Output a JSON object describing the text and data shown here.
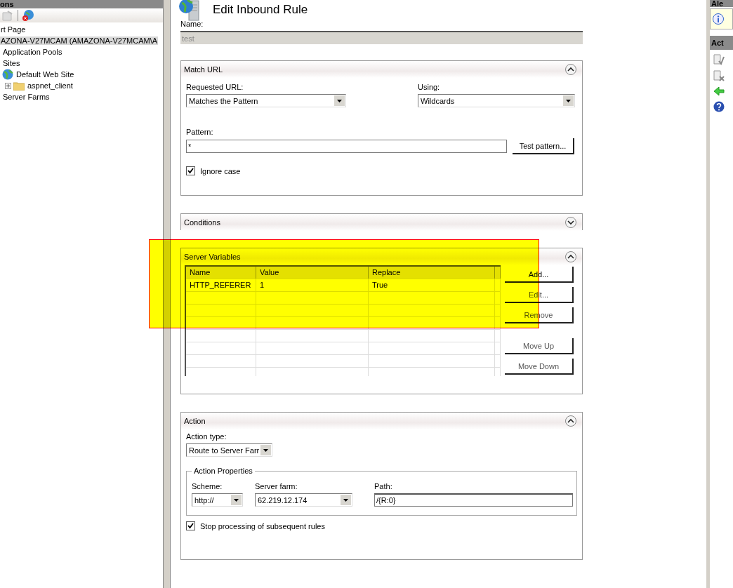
{
  "connections": {
    "title": "ons",
    "tree": [
      {
        "label": "rt Page",
        "selected": false
      },
      {
        "label": "AZONA-V27MCAM (AMAZONA-V27MCAM\\A",
        "selected": true,
        "children": [
          {
            "label": "Application Pools",
            "selected": false
          },
          {
            "label": "Sites",
            "selected": false,
            "children": [
              {
                "label": "Default Web Site",
                "selected": false,
                "kind": "site",
                "children": [
                  {
                    "label": "aspnet_client",
                    "selected": false,
                    "kind": "folder"
                  }
                ]
              }
            ]
          },
          {
            "label": "Server Farms",
            "selected": false
          }
        ]
      }
    ]
  },
  "page": {
    "title": "Edit Inbound Rule",
    "name_label": "Name:",
    "name_value": "test"
  },
  "match_url": {
    "title": "Match URL",
    "expanded": true,
    "requested_url_label": "Requested URL:",
    "requested_url": "Matches the Pattern",
    "using_label": "Using:",
    "using": "Wildcards",
    "pattern_label": "Pattern:",
    "pattern": "*",
    "test_button": "Test pattern...",
    "ignore_case": {
      "label": "Ignore case",
      "checked": true
    }
  },
  "conditions": {
    "title": "Conditions",
    "expanded": false
  },
  "server_variables": {
    "title": "Server Variables",
    "expanded": true,
    "columns": [
      "Name",
      "Value",
      "Replace"
    ],
    "rows": [
      [
        "HTTP_REFERER",
        "1",
        "True"
      ]
    ],
    "buttons": [
      {
        "label": "Add...",
        "disabled": false
      },
      {
        "label": "Edit...",
        "disabled": true
      },
      {
        "label": "Remove",
        "disabled": true
      },
      {
        "label": "Move Up",
        "disabled": true
      },
      {
        "label": "Move Down",
        "disabled": true
      }
    ]
  },
  "action": {
    "title": "Action",
    "expanded": true,
    "type_label": "Action type:",
    "type": "Route to Server Farr",
    "properties_title": "Action Properties",
    "scheme_label": "Scheme:",
    "scheme": "http://",
    "farm_label": "Server farm:",
    "farm": "62.219.12.174",
    "path_label": "Path:",
    "path": "/{R:0}",
    "stop_processing": {
      "label": "Stop processing of subsequent rules",
      "checked": true
    }
  },
  "right_panel": {
    "alerts_title": "Ale",
    "actions_title": "Act"
  }
}
